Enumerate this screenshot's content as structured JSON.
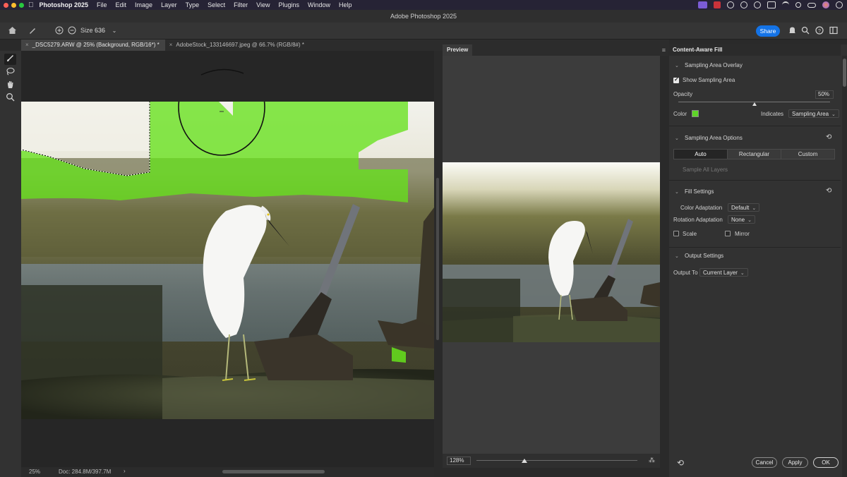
{
  "menubar": {
    "app": "Photoshop 2025",
    "items": [
      "File",
      "Edit",
      "Image",
      "Layer",
      "Type",
      "Select",
      "Filter",
      "View",
      "Plugins",
      "Window",
      "Help"
    ]
  },
  "window_title": "Adobe Photoshop 2025",
  "options": {
    "size_label": "Size",
    "size_value": "636",
    "share_label": "Share"
  },
  "tabs": [
    {
      "label": "_DSC5279.ARW @ 25% (Background, RGB/16*) *",
      "active": true
    },
    {
      "label": "AdobeStock_133146697.jpeg @ 66.7% (RGB/8#) *",
      "active": false
    }
  ],
  "status": {
    "zoom": "25%",
    "doc": "Doc: 284.8M/397.7M",
    "arrow": "›"
  },
  "preview": {
    "tab": "Preview",
    "zoom": "128%",
    "zoom_slider_fraction": 0.3
  },
  "panel": {
    "title": "Content-Aware Fill",
    "sampling_overlay": {
      "heading": "Sampling Area Overlay",
      "show_label": "Show Sampling Area",
      "show_checked": true,
      "opacity_label": "Opacity",
      "opacity_value": "50%",
      "opacity_fraction": 0.5,
      "color_label": "Color",
      "color_value": "#5fd428",
      "indicates_label": "Indicates",
      "indicates_value": "Sampling Area"
    },
    "sampling_options": {
      "heading": "Sampling Area Options",
      "modes": [
        "Auto",
        "Rectangular",
        "Custom"
      ],
      "active_mode": "Auto",
      "sample_all_layers": "Sample All Layers"
    },
    "fill_settings": {
      "heading": "Fill Settings",
      "color_adaptation_label": "Color Adaptation",
      "color_adaptation_value": "Default",
      "rotation_adaptation_label": "Rotation Adaptation",
      "rotation_adaptation_value": "None",
      "scale_label": "Scale",
      "mirror_label": "Mirror"
    },
    "output_settings": {
      "heading": "Output Settings",
      "output_to_label": "Output To",
      "output_to_value": "Current Layer"
    },
    "buttons": {
      "cancel": "Cancel",
      "apply": "Apply",
      "ok": "OK"
    }
  }
}
